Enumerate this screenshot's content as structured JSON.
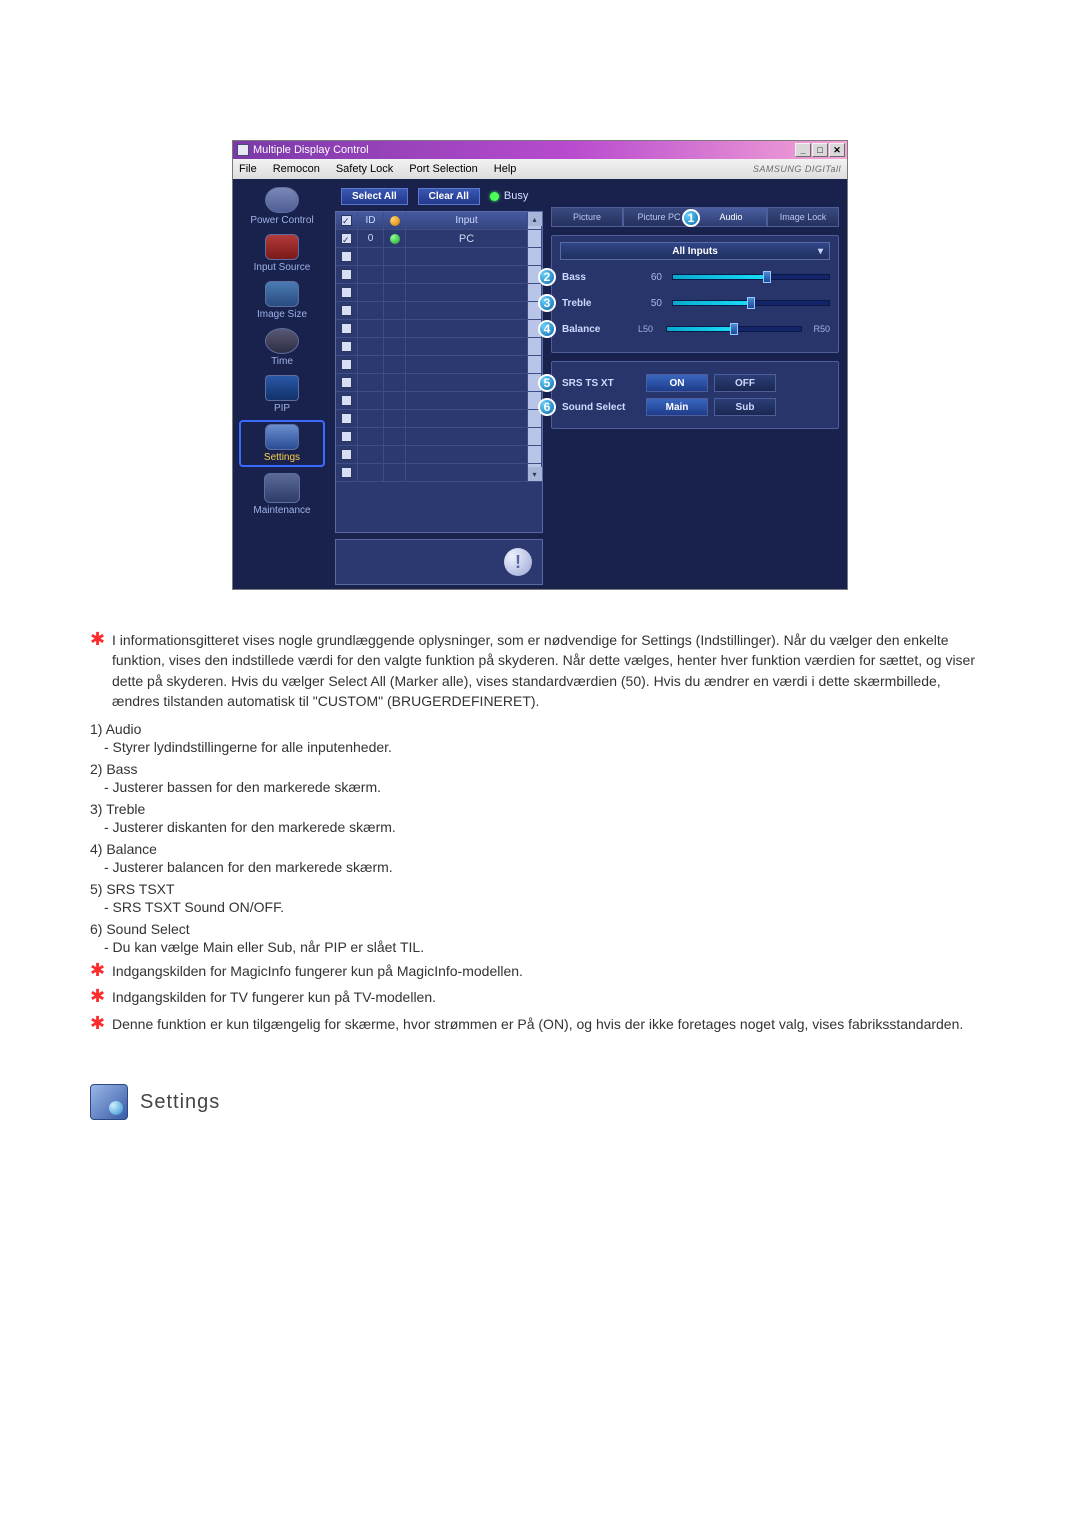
{
  "app": {
    "title": "Multiple Display Control",
    "brand": "SAMSUNG DIGITall",
    "menu": {
      "file": "File",
      "remocon": "Remocon",
      "safety": "Safety Lock",
      "port": "Port Selection",
      "help": "Help"
    },
    "toolbar": {
      "select_all": "Select All",
      "clear_all": "Clear All",
      "busy": "Busy"
    },
    "sidebar": {
      "power": "Power Control",
      "input": "Input Source",
      "size": "Image Size",
      "time": "Time",
      "pip": "PIP",
      "settings": "Settings",
      "maint": "Maintenance"
    },
    "grid": {
      "headers": {
        "id": "ID",
        "input": "Input"
      },
      "row0": {
        "id": "0",
        "input": "PC"
      }
    },
    "tabs": {
      "picture": "Picture",
      "picture_pc": "Picture PC",
      "audio": "Audio",
      "image_lock": "Image Lock",
      "audio_badge": "1"
    },
    "audio": {
      "dropdown": "All Inputs",
      "bass": {
        "label": "Bass",
        "value": "60",
        "badge": "2"
      },
      "treble": {
        "label": "Treble",
        "value": "50",
        "badge": "3"
      },
      "balance": {
        "label": "Balance",
        "left": "L50",
        "right": "R50",
        "badge": "4"
      },
      "srs": {
        "label": "SRS TS XT",
        "on": "ON",
        "off": "OFF",
        "badge": "5"
      },
      "sound_sel": {
        "label": "Sound Select",
        "main": "Main",
        "sub": "Sub",
        "badge": "6"
      }
    }
  },
  "doc": {
    "note1": "I informationsgitteret vises nogle grundlæggende oplysninger, som er nødvendige for Settings (Indstillinger). Når du vælger den enkelte funktion, vises den indstillede værdi for den valgte funktion på skyderen. Når dette vælges, henter hver funktion værdien for sættet, og viser dette på skyderen. Hvis du vælger Select All (Marker alle), vises standardværdien (50). Hvis du ændrer en værdi i dette skærmbillede, ændres tilstanden automatisk til \"CUSTOM\" (BRUGERDEFINERET).",
    "items": {
      "n1": "1)  Audio",
      "d1": "- Styrer lydindstillingerne for alle inputenheder.",
      "n2": "2)  Bass",
      "d2": "- Justerer bassen for den markerede skærm.",
      "n3": "3)  Treble",
      "d3": "- Justerer diskanten for den markerede skærm.",
      "n4": "4)  Balance",
      "d4": "- Justerer balancen for den markerede skærm.",
      "n5": "5)  SRS TSXT",
      "d5": "- SRS TSXT Sound ON/OFF.",
      "n6": "6)  Sound Select",
      "d6": "- Du kan vælge Main eller Sub, når PIP er slået TIL."
    },
    "note2": "Indgangskilden for MagicInfo fungerer kun på MagicInfo-modellen.",
    "note3": "Indgangskilden for TV fungerer kun på TV-modellen.",
    "note4": "Denne funktion er kun tilgængelig for skærme, hvor strømmen er På (ON), og hvis der ikke foretages noget valg, vises fabriksstandarden.",
    "section_title": "Settings"
  }
}
